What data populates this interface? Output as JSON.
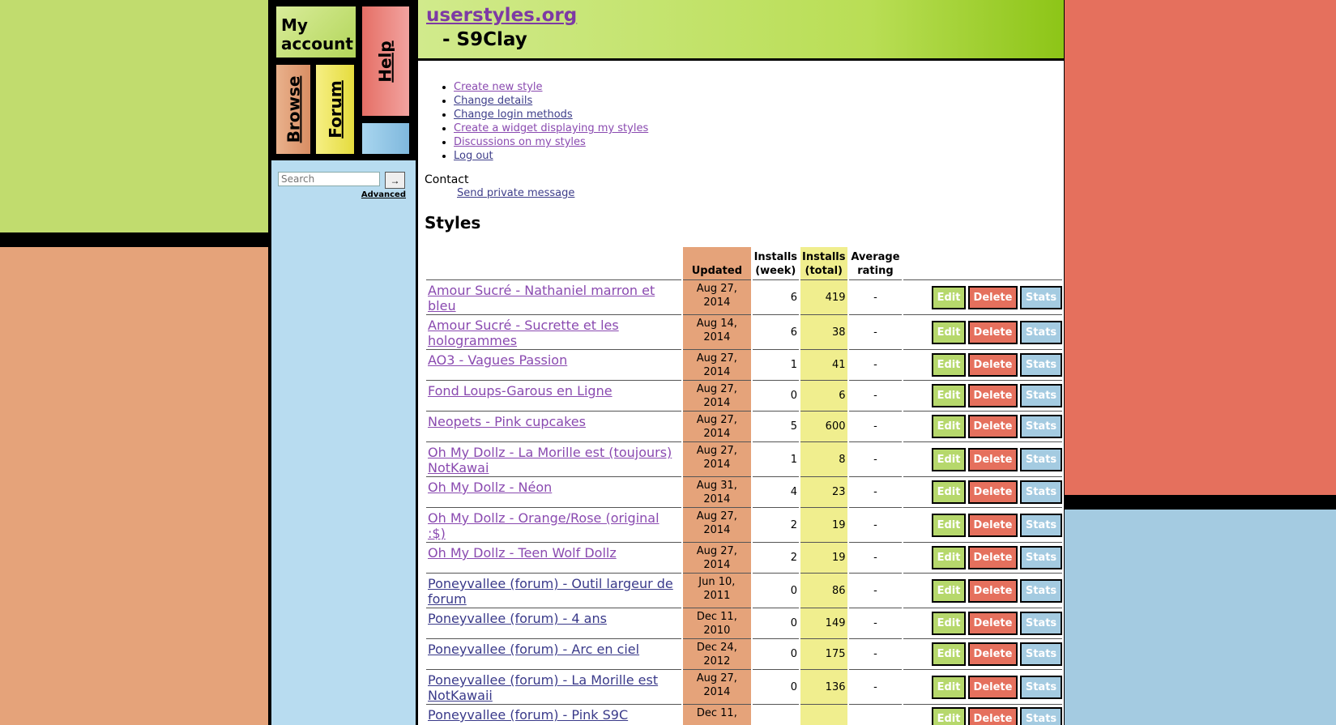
{
  "site": {
    "name": "userstyles.org",
    "user": "- S9Clay"
  },
  "nav": {
    "account_line1": "My",
    "account_line2": "account",
    "browse": "Browse",
    "forum": "Forum",
    "help": "Help"
  },
  "search": {
    "placeholder": "Search",
    "button": "→",
    "advanced": "Advanced"
  },
  "actions": [
    "Create new style",
    "Change details",
    "Change login methods",
    "Create a widget displaying my styles",
    "Discussions on my styles",
    "Log out"
  ],
  "contact": {
    "label": "Contact",
    "link": "Send private message"
  },
  "styles": {
    "heading": "Styles",
    "columns": {
      "updated": "Updated",
      "installs_week_1": "Installs",
      "installs_week_2": "(week)",
      "installs_total_1": "Installs",
      "installs_total_2": "(total)",
      "avg_1": "Average",
      "avg_2": "rating"
    },
    "buttons": {
      "edit": "Edit",
      "delete": "Delete",
      "stats": "Stats"
    },
    "rows": [
      {
        "name": "Amour Sucré - Nathaniel  marron et bleu",
        "date1": "Aug 27,",
        "date2": "2014",
        "week": "6",
        "total": "419",
        "avg": "-"
      },
      {
        "name": "Amour Sucré - Sucrette et les hologrammes",
        "date1": "Aug 14,",
        "date2": "2014",
        "week": "6",
        "total": "38",
        "avg": "-"
      },
      {
        "name": "AO3 - Vagues Passion",
        "date1": "Aug 27,",
        "date2": "2014",
        "week": "1",
        "total": "41",
        "avg": "-"
      },
      {
        "name": "Fond Loups-Garous en Ligne",
        "date1": "Aug 27,",
        "date2": "2014",
        "week": "0",
        "total": "6",
        "avg": "-"
      },
      {
        "name": "Neopets - Pink cupcakes",
        "date1": "Aug 27,",
        "date2": "2014",
        "week": "5",
        "total": "600",
        "avg": "-"
      },
      {
        "name": "Oh My Dollz - La Morille est (toujours) NotKawai",
        "date1": "Aug 27,",
        "date2": "2014",
        "week": "1",
        "total": "8",
        "avg": "-"
      },
      {
        "name": "Oh My Dollz - Néon",
        "date1": "Aug 31,",
        "date2": "2014",
        "week": "4",
        "total": "23",
        "avg": "-"
      },
      {
        "name": "Oh My Dollz - Orange/Rose (original :$)",
        "date1": "Aug 27,",
        "date2": "2014",
        "week": "2",
        "total": "19",
        "avg": "-"
      },
      {
        "name": "Oh My Dollz - Teen Wolf Dollz",
        "date1": "Aug 27,",
        "date2": "2014",
        "week": "2",
        "total": "19",
        "avg": "-"
      },
      {
        "name": "Poneyvallee (forum) - Outil  largeur de forum",
        "date1": "Jun 10,",
        "date2": "2011",
        "week": "0",
        "total": "86",
        "avg": "-"
      },
      {
        "name": "Poneyvallee (forum) - 4 ans",
        "date1": "Dec 11,",
        "date2": "2010",
        "week": "0",
        "total": "149",
        "avg": "-"
      },
      {
        "name": "Poneyvallee (forum) - Arc en ciel",
        "date1": "Dec 24,",
        "date2": "2012",
        "week": "0",
        "total": "175",
        "avg": "-"
      },
      {
        "name": "Poneyvallee (forum) - La Morille est NotKawaii",
        "date1": "Aug 27,",
        "date2": "2014",
        "week": "0",
        "total": "136",
        "avg": "-"
      },
      {
        "name": "Poneyvallee (forum) - Pink S9C",
        "date1": "Dec 11,",
        "date2": "",
        "week": "",
        "total": "",
        "avg": ""
      }
    ]
  },
  "colors": {
    "green": "#c1dc6e",
    "tan": "#e5a37a",
    "red": "#e5705d",
    "blue": "#a4cbe1",
    "yellow": "#f0ee8e",
    "link_visited": "#8a4ab0",
    "link": "#3a3a8a"
  }
}
